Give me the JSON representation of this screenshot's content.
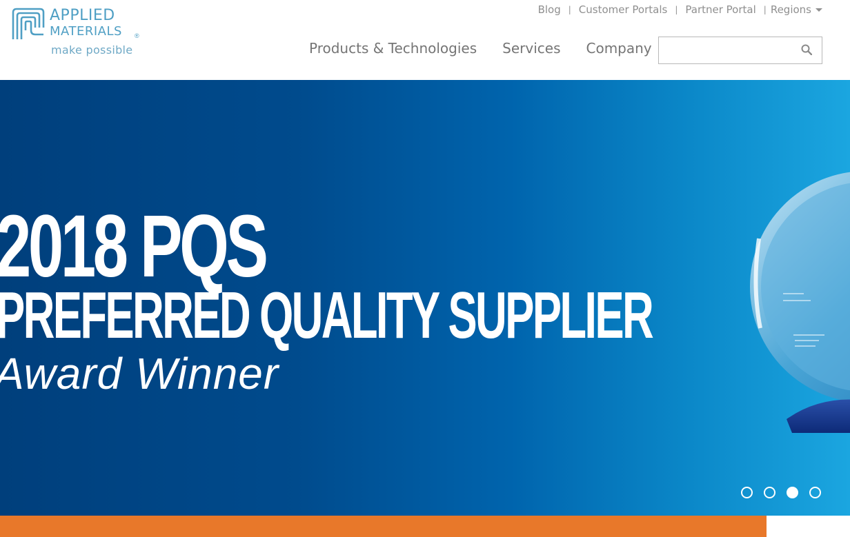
{
  "brand": {
    "name_line1": "APPLIED",
    "name_line2": "MATERIALS",
    "registered": "®",
    "tagline": "make possible",
    "logo_icon": "applied-materials-logo-icon",
    "color": "#4f9fc4"
  },
  "utility_nav": {
    "items": [
      {
        "label": "Blog"
      },
      {
        "label": "Customer Portals"
      },
      {
        "label": "Partner Portal"
      },
      {
        "label": "Regions"
      }
    ],
    "separator": "|"
  },
  "main_nav": {
    "items": [
      {
        "label": "Products & Technologies"
      },
      {
        "label": "Services"
      },
      {
        "label": "Company"
      }
    ]
  },
  "search": {
    "placeholder": "",
    "value": "",
    "icon": "search-icon"
  },
  "hero": {
    "line1": "2018 PQS",
    "line2": "PREFERRED QUALITY SUPPLIER",
    "line3": "Award Winner",
    "background_start": "#003f7c",
    "background_end": "#1ba6e0",
    "image": "award-trophy"
  },
  "carousel": {
    "slide_count": 4,
    "active_index": 2
  },
  "accent_bar_color": "#e8782a"
}
